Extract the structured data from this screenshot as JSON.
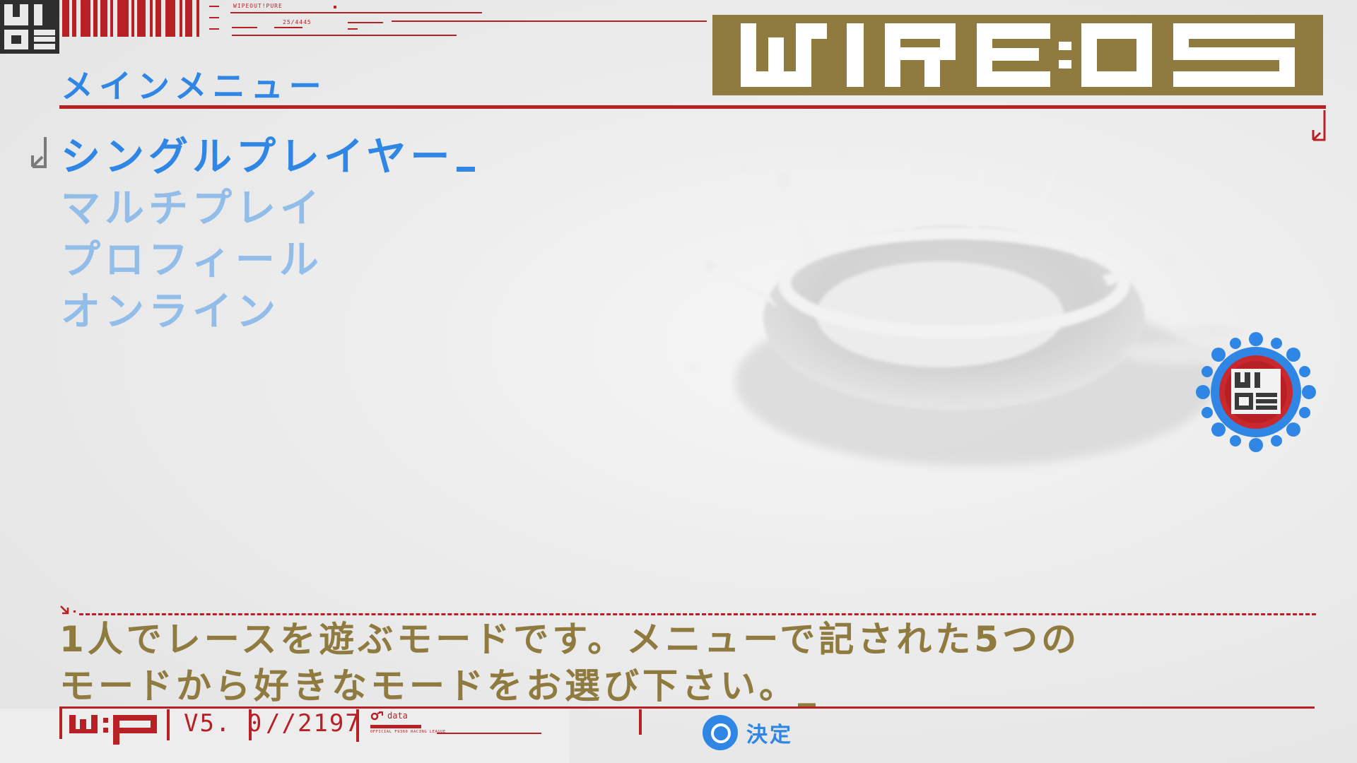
{
  "header": {
    "logo_lines": [
      "WI",
      "05"
    ],
    "mini_text_top": "WIPEOUT!PURE",
    "mini_text_bottom": "25/4445",
    "menu_title": "メインメニュー",
    "brand_title": "WIRE05"
  },
  "menu": {
    "items": [
      {
        "label": "シングルプレイヤー",
        "selected": true
      },
      {
        "label": "マルチプレイ",
        "selected": false
      },
      {
        "label": "プロフィール",
        "selected": false
      },
      {
        "label": "オンライン",
        "selected": false
      }
    ]
  },
  "description": {
    "text": "1人でレースを遊ぶモードです。メニューで記された5つの\nモードから好きなモードをお選び下さい。_"
  },
  "footer": {
    "wip_logo": "W:P",
    "version": "V5. 0",
    "year": "//2197",
    "data_label": "data",
    "league_text": "OFFICIAL F9360 RACING LEAGUE",
    "confirm_label": "決定"
  },
  "emblem": {
    "text_top": "WI",
    "text_bottom": "05"
  },
  "colors": {
    "accent_red": "#b72126",
    "accent_blue": "#2f86e4",
    "dim_blue": "#93bde9",
    "gold": "#8f7a3f"
  }
}
